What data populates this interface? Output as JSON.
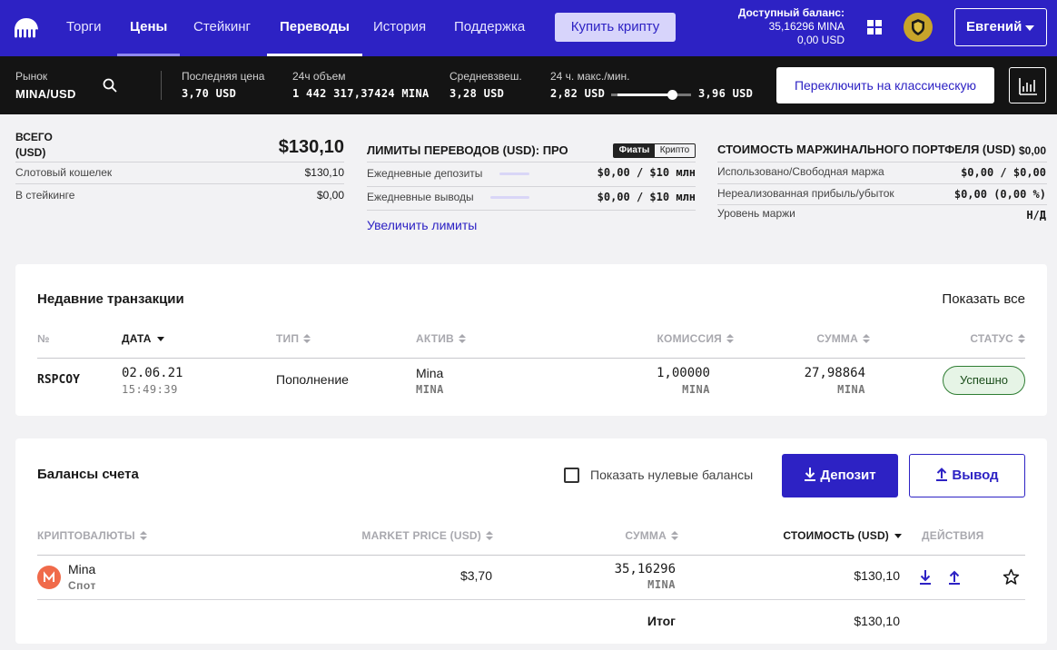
{
  "nav": {
    "items": [
      "Торги",
      "Цены",
      "Стейкинг",
      "Переводы",
      "История",
      "Поддержка"
    ],
    "buy_label": "Купить крипту",
    "balance_title": "Доступный баланс:",
    "balance_mina": "35,16296 MINA",
    "balance_usd": "0,00 USD",
    "user_name": "Евгений"
  },
  "market": {
    "market_label": "Рынок",
    "pair": "MINA/USD",
    "last_price_label": "Последняя цена",
    "last_price": "3,70 USD",
    "volume_label": "24ч объем",
    "volume": "1 442 317,37424 MINA",
    "vwap_label": "Средневзвеш.",
    "vwap": "3,28 USD",
    "range_label": "24 ч. макс./мин.",
    "range_low": "2,82 USD",
    "range_high": "3,96 USD",
    "range_position": 0.77,
    "switch_label": "Переключить на классическую"
  },
  "summary": {
    "total_label": "ВСЕГО",
    "total_unit": "(USD)",
    "total_value": "$130,10",
    "spot_label": "Слотовый кошелек",
    "spot_value": "$130,10",
    "staking_label": "В стейкинге",
    "staking_value": "$0,00"
  },
  "limits": {
    "title": "ЛИМИТЫ ПЕРЕВОДОВ (USD): ПРО",
    "toggle_on": "Фиаты",
    "toggle_off": "Крипто",
    "deposits_label": "Ежедневные депозиты",
    "deposits_value": "$0,00 / $10 млн",
    "withdrawals_label": "Ежедневные выводы",
    "withdrawals_value": "$0,00 / $10 млн",
    "increase_link": "Увеличить лимиты"
  },
  "margin": {
    "title": "СТОИМОСТЬ МАРЖИНАЛЬНОГО ПОРТФЕЛЯ (USD)",
    "title_value": "$0,00",
    "used_label": "Использовано/Свободная маржа",
    "used_value": "$0,00 / $0,00",
    "unrealized_label": "Нереализованная прибыль/убыток",
    "unrealized_value": "$0,00 (0,00 %)",
    "level_label": "Уровень маржи",
    "level_value": "Н/Д"
  },
  "transactions": {
    "title": "Недавние транзакции",
    "show_all": "Показать все",
    "headers": [
      "№",
      "ДАТА",
      "ТИП",
      "АКТИВ",
      "КОМИССИЯ",
      "СУММА",
      "СТАТУС"
    ],
    "rows": [
      {
        "id": "RSPCOY",
        "date": "02.06.21",
        "time": "15:49:39",
        "type": "Пополнение",
        "asset": "Mina",
        "asset_code": "MINA",
        "fee": "1,00000",
        "fee_unit": "MINA",
        "amount": "27,98864",
        "amount_unit": "MINA",
        "status": "Успешно"
      }
    ]
  },
  "balances": {
    "title": "Балансы счета",
    "show_zero_label": "Показать нулевые балансы",
    "deposit_label": "Депозит",
    "withdraw_label": "Вывод",
    "headers": [
      "КРИПТОВАЛЮТЫ",
      "MARKET PRICE (USD)",
      "СУММА",
      "СТОИМОСТЬ (USD)",
      "ДЕЙСТВИЯ"
    ],
    "rows": [
      {
        "name": "Mina",
        "wallet": "Спот",
        "price": "$3,70",
        "amount": "35,16296",
        "amount_unit": "MINA",
        "value": "$130,10"
      }
    ],
    "total_label": "Итог",
    "total_value": "$130,10"
  },
  "colors": {
    "brand": "#2d22c4",
    "success": "#2e7d32",
    "mina": "#f06a4a"
  }
}
